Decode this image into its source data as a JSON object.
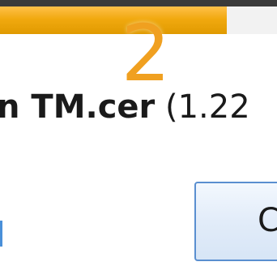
{
  "progress": {
    "step": "2",
    "fill_fraction": 0.82,
    "fill_color": "#f1a90f"
  },
  "status": {
    "filename": "n TM.cer",
    "filesize": "(1.22"
  },
  "dialog": {
    "button_label": "C",
    "button_border_color": "#5a8fd0"
  }
}
